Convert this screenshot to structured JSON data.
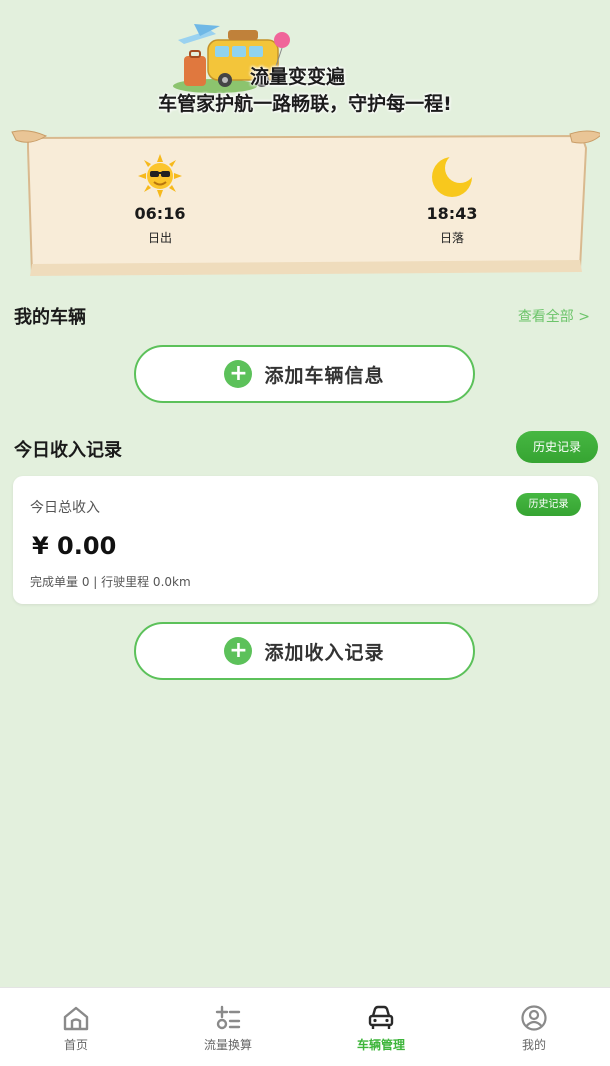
{
  "banner": {
    "slogan_line1": "流量变变遍",
    "slogan_line2": "车管家护航一路畅联，守护每一程!"
  },
  "sun_times": {
    "sunrise": {
      "time": "06:16",
      "label": "日出",
      "icon": "sun-icon"
    },
    "sunset": {
      "time": "18:43",
      "label": "日落",
      "icon": "moon-icon"
    }
  },
  "vehicles": {
    "title": "我的车辆",
    "view_all": "查看全部 >",
    "add_label": "添加车辆信息"
  },
  "income": {
    "title": "今日收入记录",
    "history_button": "历史记录",
    "card": {
      "title": "今日总收入",
      "history_button": "历史记录",
      "amount": "¥ 0.00",
      "summary": "完成单量 0 | 行驶里程 0.0km"
    },
    "add_label": "添加收入记录"
  },
  "tabbar": {
    "items": [
      {
        "label": "首页",
        "icon": "home-icon"
      },
      {
        "label": "流量换算",
        "icon": "calculator-icon"
      },
      {
        "label": "车辆管理",
        "icon": "car-icon"
      },
      {
        "label": "我的",
        "icon": "user-icon"
      }
    ],
    "active_index": 2
  },
  "colors": {
    "background": "#e3f0dd",
    "accent": "#5cc15a",
    "active_tab": "#3db53a"
  }
}
